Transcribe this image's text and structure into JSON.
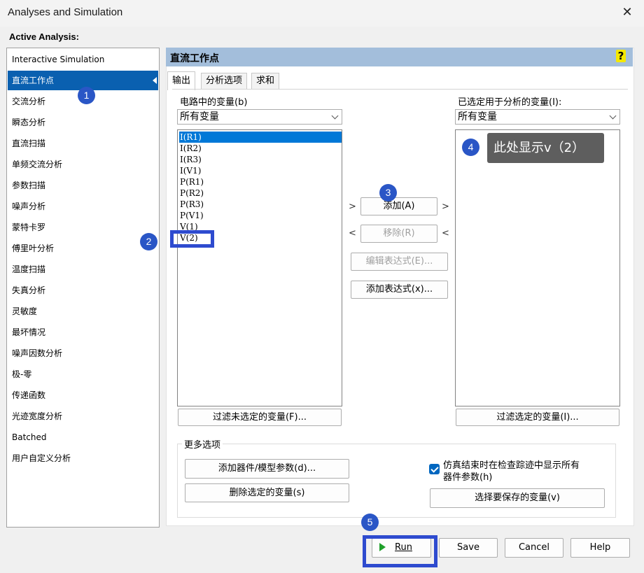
{
  "window": {
    "title": "Analyses and Simulation",
    "close_glyph": "✕"
  },
  "active_analysis_label": "Active Analysis:",
  "analyses": [
    "Interactive Simulation",
    "直流工作点",
    "交流分析",
    "瞬态分析",
    "直流扫描",
    "单频交流分析",
    "参数扫描",
    "噪声分析",
    "蒙特卡罗",
    "傅里叶分析",
    "温度扫描",
    "失真分析",
    "灵敏度",
    "最坏情况",
    "噪声因数分析",
    "极-零",
    "传递函数",
    "光迹宽度分析",
    "Batched",
    "用户自定义分析"
  ],
  "selected_analysis": "直流工作点",
  "panel": {
    "title": "直流工作点",
    "help_glyph": "?",
    "tabs": [
      "输出",
      "分析选项",
      "求和"
    ],
    "active_tab": "输出"
  },
  "circuit_vars": {
    "label": "电路中的变量(b)",
    "filter_value": "所有变量",
    "items": [
      "I(R1)",
      "I(R2)",
      "I(R3)",
      "I(V1)",
      "P(R1)",
      "P(R2)",
      "P(R3)",
      "P(V1)",
      "V(1)",
      "V(2)"
    ],
    "selected": "I(R1)",
    "filter_button": "过滤未选定的变量(F)..."
  },
  "selected_vars": {
    "label": "已选定用于分析的变量(I):",
    "filter_value": "所有变量",
    "filter_button": "过滤选定的变量(I)..."
  },
  "middle_buttons": {
    "add": "添加(A)",
    "remove": "移除(R)",
    "edit_expr": "编辑表达式(E)...",
    "add_expr": "添加表达式(x)...",
    "right_arrow": ">",
    "left_arrow": "<"
  },
  "more_options": {
    "title": "更多选项",
    "add_param": "添加器件/模型参数(d)...",
    "delete_selected": "删除选定的变量(s)",
    "checkbox_label_1": "仿真结束时在检查踪迹中显示所有",
    "checkbox_label_2": "器件参数(h)",
    "checkbox_checked": true,
    "save_vars": "选择要保存的变量(v)"
  },
  "footer": {
    "run": "Run",
    "save": "Save",
    "cancel": "Cancel",
    "help": "Help"
  },
  "annotations": {
    "badges": [
      "1",
      "2",
      "3",
      "4",
      "5"
    ],
    "tooltip": "此处显示v（2）",
    "highlight_color": "#2e4bcf",
    "badge_color": "#2a56c6"
  }
}
